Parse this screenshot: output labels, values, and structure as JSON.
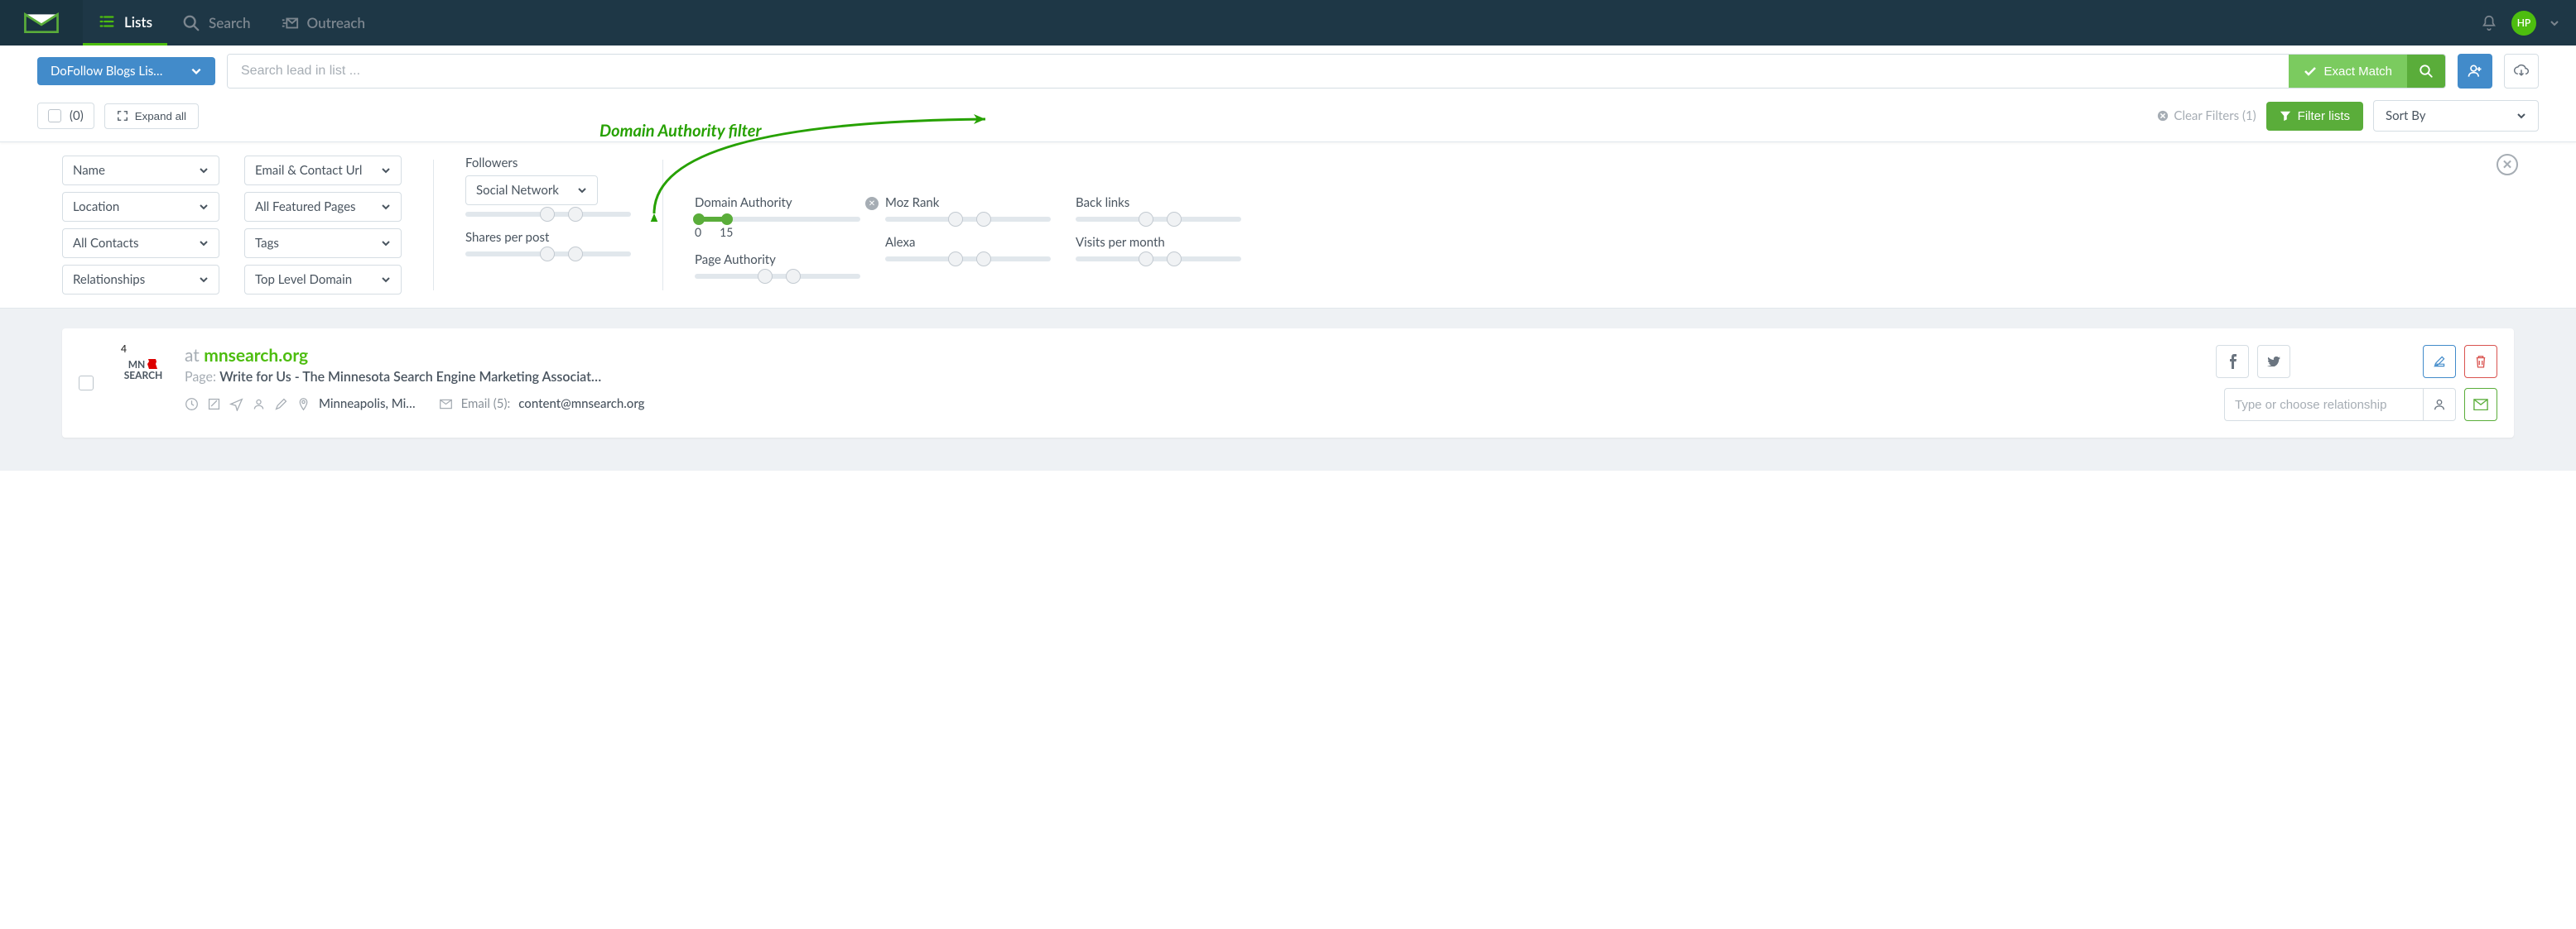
{
  "nav": {
    "lists": "Lists",
    "search": "Search",
    "outreach": "Outreach",
    "avatar_initials": "HP"
  },
  "toolbar": {
    "list_name": "DoFollow Blogs Lis…",
    "search_placeholder": "Search lead in list ...",
    "exact_match": "Exact Match",
    "selected_count": "(0)",
    "expand_all": "Expand all",
    "clear_filters": "Clear Filters (1)",
    "filter_lists": "Filter lists",
    "sort_by": "Sort By"
  },
  "filters": {
    "selects_col1": [
      "Name",
      "Location",
      "All Contacts",
      "Relationships"
    ],
    "selects_col2": [
      "Email & Contact Url",
      "All Featured Pages",
      "Tags",
      "Top Level Domain"
    ],
    "followers_label": "Followers",
    "social_network": "Social Network",
    "shares_label": "Shares per post",
    "da": {
      "label": "Domain Authority",
      "min": "0",
      "max": "15"
    },
    "pa_label": "Page Authority",
    "moz_label": "Moz Rank",
    "alexa_label": "Alexa",
    "backlinks_label": "Back links",
    "visits_label": "Visits per month"
  },
  "card": {
    "rank": "4",
    "logo_line1": "MN",
    "logo_line2": "SEARCH",
    "at": "at",
    "domain": "mnsearch.org",
    "page_prefix": "Page:",
    "page_title": "Write for Us - The Minnesota Search Engine Marketing Associat…",
    "location": "Minneapolis, Mi…",
    "email_label": "Email (5):",
    "email": "content@mnsearch.org",
    "rel_placeholder": "Type or choose relationship"
  },
  "annotation": {
    "text": "Domain Authority filter"
  }
}
